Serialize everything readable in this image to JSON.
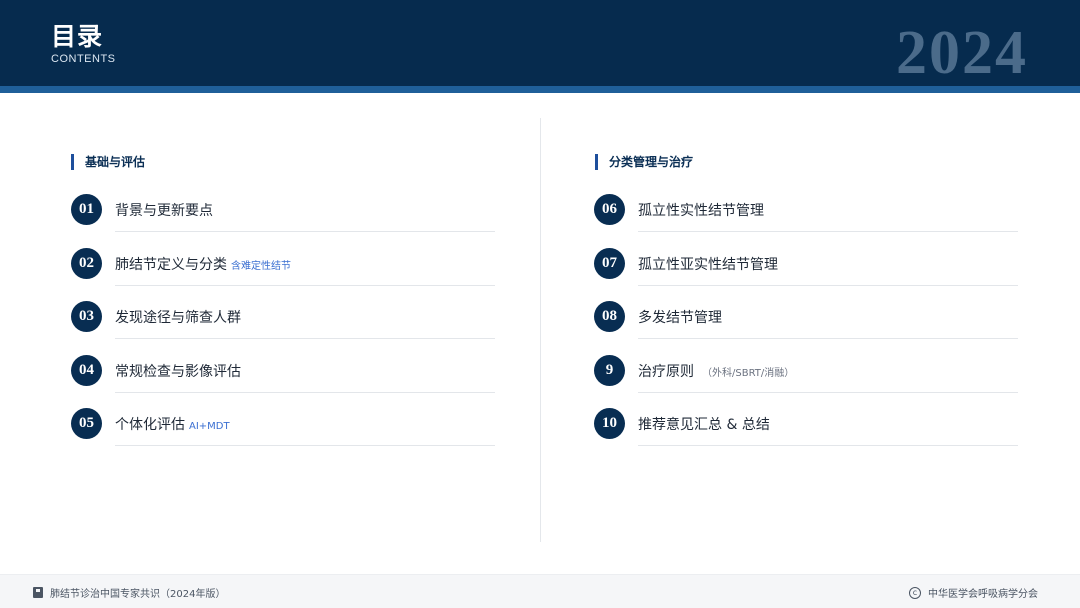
{
  "header": {
    "title": "目录",
    "subtitle": "CONTENTS",
    "year": "2024"
  },
  "sections": {
    "left": {
      "heading": "基础与评估",
      "items": [
        {
          "num": "01",
          "label": "背景与更新要点",
          "tag": ""
        },
        {
          "num": "02",
          "label": "肺结节定义与分类",
          "tag": "含难定性结节"
        },
        {
          "num": "03",
          "label": "发现途径与筛查人群",
          "tag": ""
        },
        {
          "num": "04",
          "label": "常规检查与影像评估",
          "tag": ""
        },
        {
          "num": "05",
          "label": "个体化评估",
          "tag": "AI+MDT"
        }
      ]
    },
    "right": {
      "heading": "分类管理与治疗",
      "items": [
        {
          "num": "06",
          "label": "孤立性实性结节管理",
          "tag": ""
        },
        {
          "num": "07",
          "label": "孤立性亚实性结节管理",
          "tag": ""
        },
        {
          "num": "08",
          "label": "多发结节管理",
          "tag": ""
        },
        {
          "num": "9",
          "label": "治疗原则",
          "tag": "（外科/SBRT/消融）"
        },
        {
          "num": "10",
          "label": "推荐意见汇总 & 总结",
          "tag": ""
        }
      ]
    }
  },
  "footer": {
    "left_text": "肺结节诊治中国专家共识（2024年版）",
    "right_text": "中华医学会呼吸病学分会",
    "left_icon": "book-icon",
    "right_icon": "copyright-icon"
  },
  "colors": {
    "header_bg": "#062b4e",
    "stripe": "#1f5f99",
    "accent_tag": "#3b6fd1",
    "number_circle": "#082d52"
  }
}
